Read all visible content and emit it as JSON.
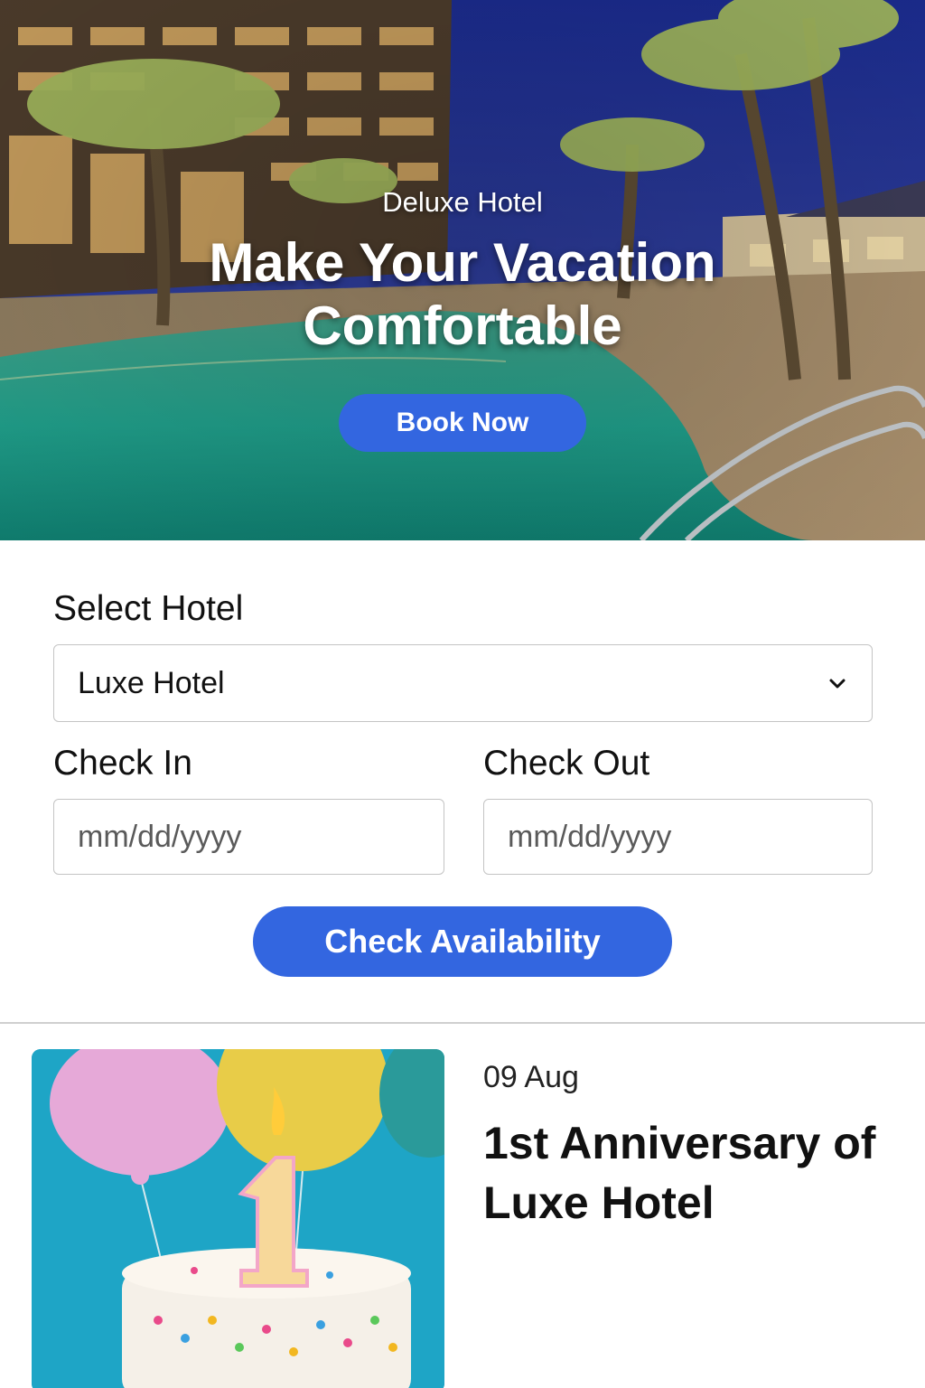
{
  "hero": {
    "eyebrow": "Deluxe Hotel",
    "title": "Make Your Vacation Comfortable",
    "book_label": "Book Now"
  },
  "booking": {
    "hotel_label": "Select Hotel",
    "hotel_value": "Luxe Hotel",
    "checkin_label": "Check In",
    "checkin_placeholder": "mm/dd/yyyy",
    "checkout_label": "Check Out",
    "checkout_placeholder": "mm/dd/yyyy",
    "availability_label": "Check Availability"
  },
  "event": {
    "date": "09 Aug",
    "title": "1st Anniversary of Luxe Hotel",
    "image_icon": "birthday-cake-candle-icon"
  },
  "colors": {
    "accent": "#3366e0",
    "border": "#c4c4c4",
    "text": "#111111"
  }
}
